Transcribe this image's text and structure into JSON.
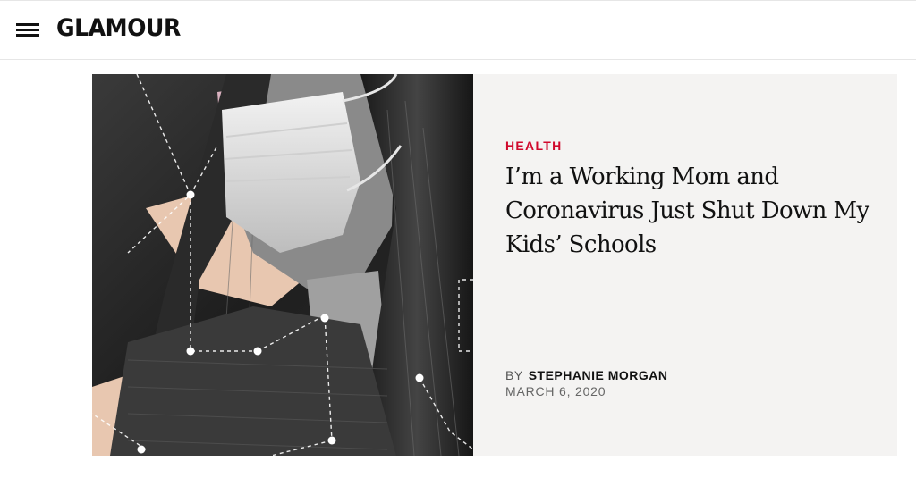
{
  "header": {
    "brand": "GLAMOUR",
    "menu_icon": "hamburger-menu-icon"
  },
  "article": {
    "category": "HEALTH",
    "headline": "I’m a Working Mom and Coronavirus Just Shut Down My Kids’ Schools",
    "byline_prefix": "BY",
    "author": "STEPHANIE MORGAN",
    "date": "MARCH 6, 2020",
    "image": "collage-woman-wearing-surgical-mask",
    "colors": {
      "category": "#d0092c",
      "card_background": "#f4f3f2",
      "pink_accent": "#d9b1bf",
      "peach_accent": "#e8c7b0"
    }
  }
}
